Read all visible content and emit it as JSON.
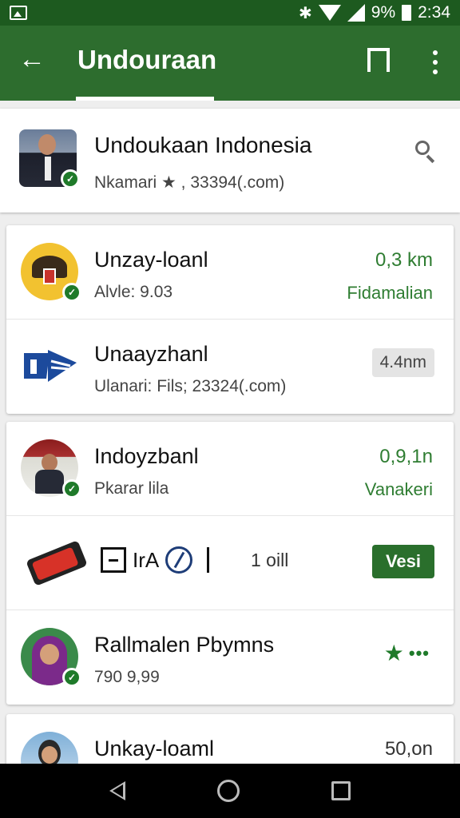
{
  "status_bar": {
    "battery": "9%",
    "time": "2:34"
  },
  "app_bar": {
    "title": "Undouraan"
  },
  "header": {
    "name": "Undoukaan Indonesia",
    "subtitle": "Nkamari ★ , 33394(.com)"
  },
  "cards": [
    {
      "rows": [
        {
          "name": "Unzay-loanl",
          "sub": "Alvle: 9.03",
          "right_top": "0,3 km",
          "right_bottom": "Fidamalian"
        },
        {
          "name": "Unaayzhanl",
          "sub": "Ulanari: Fils; 23324(.com)",
          "chip": "4.4nm"
        }
      ]
    },
    {
      "rows": [
        {
          "name": "Indoyzbanl",
          "sub": "Pkarar lila",
          "right_top": "0,9,1n",
          "right_bottom": "Vanakeri"
        },
        {
          "tools_text": "IrA",
          "count": "1 oill",
          "button": "Vesi"
        },
        {
          "name": "Rallmalen Pbymns",
          "sub": "790 9,99",
          "more": "•••"
        }
      ]
    },
    {
      "rows": [
        {
          "name": "Unkay-loaml",
          "right_top": "50,on"
        }
      ]
    }
  ],
  "icons": {
    "status_left": "image-icon",
    "search": "search-icon",
    "back": "arrow-left-icon",
    "bookmark": "bookmark-icon",
    "menu": "more-vert-icon"
  },
  "colors": {
    "app_bar": "#2d6d2e",
    "status_bar": "#1d5a1f",
    "accent": "#2f7d32"
  }
}
